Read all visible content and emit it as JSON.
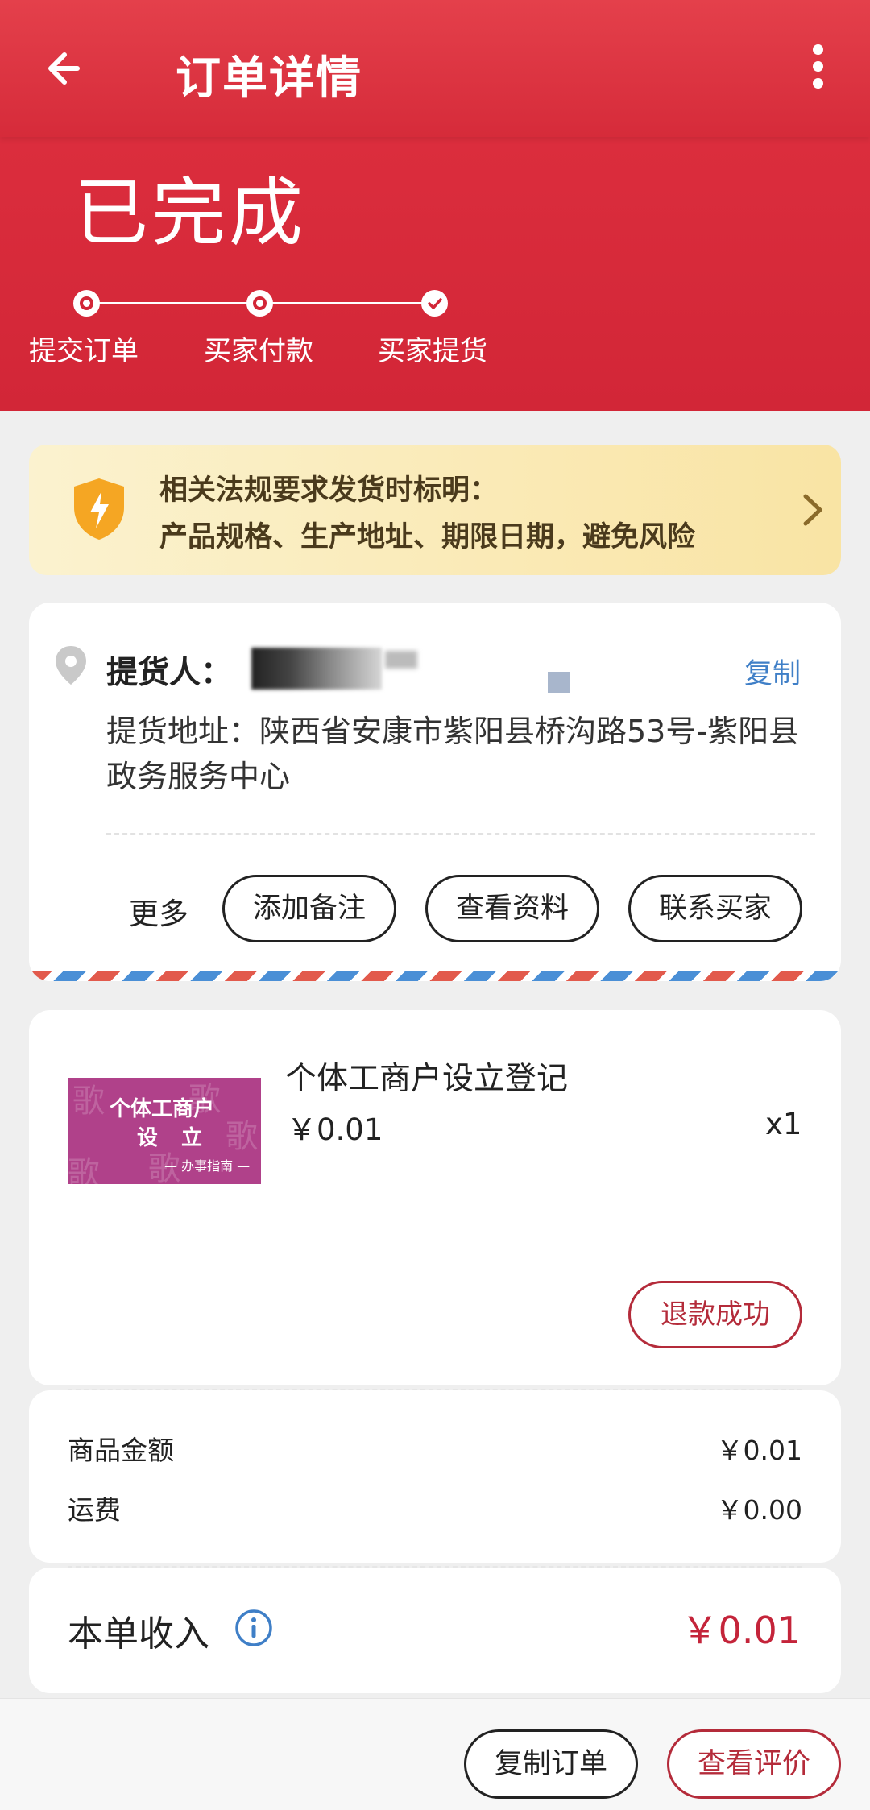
{
  "header": {
    "title": "订单详情",
    "status": "已完成",
    "steps": [
      {
        "label": "提交订单"
      },
      {
        "label": "买家付款"
      },
      {
        "label": "买家提货"
      }
    ]
  },
  "notice": {
    "line1": "相关法规要求发货时标明：",
    "line2": "产品规格、生产地址、期限日期，避免风险"
  },
  "pickup": {
    "label": "提货人：",
    "copy_label": "复制",
    "address": "提货地址：陕西省安康市紫阳县桥沟路53号-紫阳县政务服务中心",
    "more_label": "更多",
    "buttons": [
      "添加备注",
      "查看资料",
      "联系买家"
    ]
  },
  "product": {
    "image_text": [
      "个体工商户",
      "设 立",
      "— 办事指南 —"
    ],
    "name": "个体工商户设立登记",
    "price": "￥0.01",
    "quantity": "x1",
    "refund_status": "退款成功"
  },
  "fees": [
    {
      "label": "商品金额",
      "value": "￥0.01"
    },
    {
      "label": "运费",
      "value": "￥0.00"
    }
  ],
  "income": {
    "label": "本单收入",
    "value": "￥0.01"
  },
  "bottom_bar": {
    "copy_order": "复制订单",
    "view_review": "查看评价"
  },
  "colors": {
    "brand_red": "#d22637",
    "link_blue": "#3f7fc7",
    "accent_red_text": "#b42b3a",
    "notice_bg": "#f9e4a4"
  },
  "icons": [
    "back-arrow-icon",
    "more-vertical-icon",
    "shield-lightning-icon",
    "chevron-right-icon",
    "location-pin-icon",
    "info-icon",
    "check-icon"
  ]
}
